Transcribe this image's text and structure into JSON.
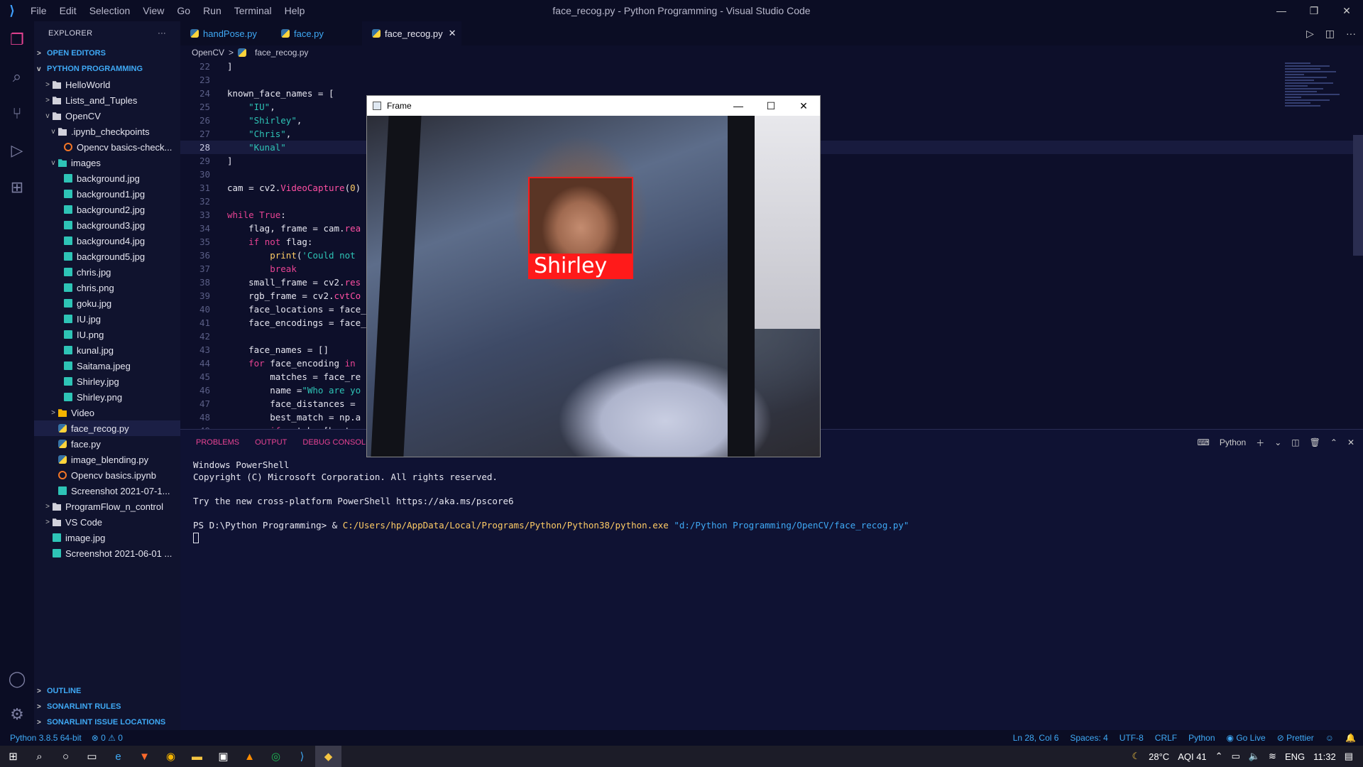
{
  "titlebar": {
    "menu": [
      "File",
      "Edit",
      "Selection",
      "View",
      "Go",
      "Run",
      "Terminal",
      "Help"
    ],
    "title": "face_recog.py - Python Programming - Visual Studio Code"
  },
  "explorer": {
    "header": "EXPLORER",
    "open_editors": "OPEN EDITORS",
    "project": "PYTHON PROGRAMMING",
    "items": [
      {
        "label": "HelloWorld",
        "depth": 1,
        "kind": "folder",
        "chev": ">"
      },
      {
        "label": "Lists_and_Tuples",
        "depth": 1,
        "kind": "folder",
        "chev": ">"
      },
      {
        "label": "OpenCV",
        "depth": 1,
        "kind": "folder",
        "chev": "v"
      },
      {
        "label": ".ipynb_checkpoints",
        "depth": 2,
        "kind": "folder",
        "chev": "v"
      },
      {
        "label": "Opencv basics-check...",
        "depth": 3,
        "kind": "nb",
        "chev": ""
      },
      {
        "label": "images",
        "depth": 2,
        "kind": "folder-img",
        "chev": "v"
      },
      {
        "label": "background.jpg",
        "depth": 3,
        "kind": "img",
        "chev": ""
      },
      {
        "label": "background1.jpg",
        "depth": 3,
        "kind": "img",
        "chev": ""
      },
      {
        "label": "background2.jpg",
        "depth": 3,
        "kind": "img",
        "chev": ""
      },
      {
        "label": "background3.jpg",
        "depth": 3,
        "kind": "img",
        "chev": ""
      },
      {
        "label": "background4.jpg",
        "depth": 3,
        "kind": "img",
        "chev": ""
      },
      {
        "label": "background5.jpg",
        "depth": 3,
        "kind": "img",
        "chev": ""
      },
      {
        "label": "chris.jpg",
        "depth": 3,
        "kind": "img",
        "chev": ""
      },
      {
        "label": "chris.png",
        "depth": 3,
        "kind": "img",
        "chev": ""
      },
      {
        "label": "goku.jpg",
        "depth": 3,
        "kind": "img",
        "chev": ""
      },
      {
        "label": "IU.jpg",
        "depth": 3,
        "kind": "img",
        "chev": ""
      },
      {
        "label": "IU.png",
        "depth": 3,
        "kind": "img",
        "chev": ""
      },
      {
        "label": "kunal.jpg",
        "depth": 3,
        "kind": "img",
        "chev": ""
      },
      {
        "label": "Saitama.jpeg",
        "depth": 3,
        "kind": "img",
        "chev": ""
      },
      {
        "label": "Shirley.jpg",
        "depth": 3,
        "kind": "img",
        "chev": ""
      },
      {
        "label": "Shirley.png",
        "depth": 3,
        "kind": "img",
        "chev": ""
      },
      {
        "label": "Video",
        "depth": 2,
        "kind": "folder-vid",
        "chev": ">"
      },
      {
        "label": "face_recog.py",
        "depth": 2,
        "kind": "py",
        "chev": "",
        "selected": true
      },
      {
        "label": "face.py",
        "depth": 2,
        "kind": "py",
        "chev": ""
      },
      {
        "label": "image_blending.py",
        "depth": 2,
        "kind": "py",
        "chev": ""
      },
      {
        "label": "Opencv basics.ipynb",
        "depth": 2,
        "kind": "nb",
        "chev": ""
      },
      {
        "label": "Screenshot 2021-07-1...",
        "depth": 2,
        "kind": "img",
        "chev": ""
      },
      {
        "label": "ProgramFlow_n_control",
        "depth": 1,
        "kind": "folder",
        "chev": ">"
      },
      {
        "label": "VS Code",
        "depth": 1,
        "kind": "folder",
        "chev": ">"
      },
      {
        "label": "image.jpg",
        "depth": 1,
        "kind": "img",
        "chev": ""
      },
      {
        "label": "Screenshot 2021-06-01 ...",
        "depth": 1,
        "kind": "img",
        "chev": ""
      }
    ],
    "bottom_sections": [
      "OUTLINE",
      "SONARLINT RULES",
      "SONARLINT ISSUE LOCATIONS"
    ]
  },
  "tabs": [
    {
      "label": "handPose.py",
      "active": false
    },
    {
      "label": "face.py",
      "active": false
    },
    {
      "label": "face_recog.py",
      "active": true
    }
  ],
  "breadcrumb": {
    "folder": "OpenCV",
    "file": "face_recog.py"
  },
  "code": [
    {
      "n": "22",
      "html": "]"
    },
    {
      "n": "23",
      "html": ""
    },
    {
      "n": "24",
      "html": "known_face_names = ["
    },
    {
      "n": "25",
      "html": "    <span class='str'>\"IU\"</span>,"
    },
    {
      "n": "26",
      "html": "    <span class='str'>\"Shirley\"</span>,"
    },
    {
      "n": "27",
      "html": "    <span class='str'>\"Chris\"</span>,"
    },
    {
      "n": "28",
      "html": "    <span class='str'>\"Kunal\"</span>",
      "cur": true
    },
    {
      "n": "29",
      "html": "]"
    },
    {
      "n": "30",
      "html": ""
    },
    {
      "n": "31",
      "html": "cam = cv2.<span class='fn'>VideoCapture</span>(<span class='str2'>0</span>)"
    },
    {
      "n": "32",
      "html": ""
    },
    {
      "n": "33",
      "html": "<span class='kw'>while</span> <span class='kw'>True</span>:"
    },
    {
      "n": "34",
      "html": "    flag, frame = cam.<span class='fn'>rea</span>"
    },
    {
      "n": "35",
      "html": "    <span class='kw'>if</span> <span class='kw'>not</span> flag:"
    },
    {
      "n": "36",
      "html": "        <span class='str2'>print</span>(<span class='str'>'Could not</span>"
    },
    {
      "n": "37",
      "html": "        <span class='kw'>break</span>"
    },
    {
      "n": "38",
      "html": "    small_frame = cv2.<span class='fn'>res</span>"
    },
    {
      "n": "39",
      "html": "    rgb_frame = cv2.<span class='fn'>cvtCo</span>"
    },
    {
      "n": "40",
      "html": "    face_locations = face_"
    },
    {
      "n": "41",
      "html": "    face_encodings = face_"
    },
    {
      "n": "42",
      "html": ""
    },
    {
      "n": "43",
      "html": "    face_names = []"
    },
    {
      "n": "44",
      "html": "    <span class='kw'>for</span> face_encoding <span class='kw'>in</span>"
    },
    {
      "n": "45",
      "html": "        matches = face_re"
    },
    {
      "n": "46",
      "html": "        name =<span class='str'>\"Who are yo</span>"
    },
    {
      "n": "47",
      "html": "        face_distances ="
    },
    {
      "n": "48",
      "html": "        best_match = np.a"
    },
    {
      "n": "49",
      "html": "        <span class='kw'>if</span> matches[best_m"
    }
  ],
  "panel": {
    "tabs": [
      "PROBLEMS",
      "OUTPUT",
      "DEBUG CONSOLE"
    ],
    "shell": "Python",
    "lines": [
      "Windows PowerShell",
      "Copyright (C) Microsoft Corporation. All rights reserved.",
      "",
      "Try the new cross-platform PowerShell https://aka.ms/pscore6",
      ""
    ],
    "prompt": "PS D:\\Python Programming> & ",
    "exe": "C:/Users/hp/AppData/Local/Programs/Python/Python38/python.exe",
    "arg": "\"d:/Python Programming/OpenCV/face_recog.py\""
  },
  "frame_window": {
    "title": "Frame",
    "detected_name": "Shirley"
  },
  "status": {
    "interpreter": "Python 3.8.5 64-bit",
    "errors": "0",
    "warnings": "0",
    "position": "Ln 28, Col 6",
    "spaces": "Spaces: 4",
    "encoding": "UTF-8",
    "eol": "CRLF",
    "language": "Python",
    "golive": "Go Live",
    "prettier": "Prettier"
  },
  "taskbar": {
    "weather": "28°C",
    "aqi": "AQI 41",
    "lang": "ENG",
    "time": "11:32"
  }
}
